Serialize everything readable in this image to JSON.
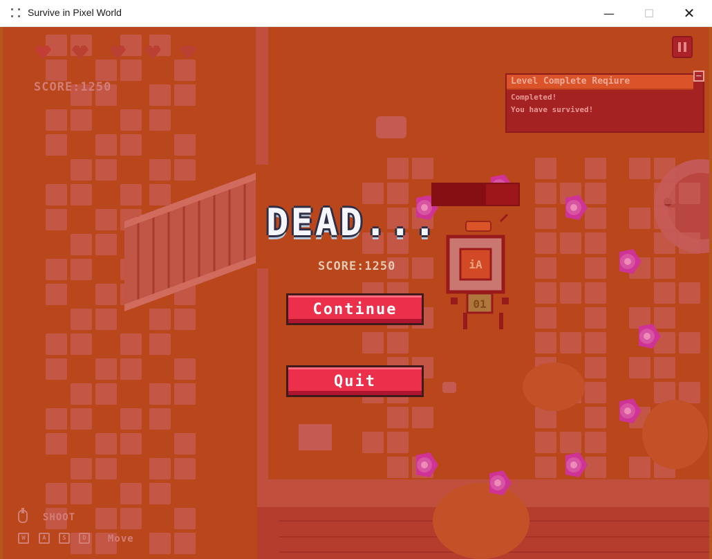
{
  "window": {
    "title": "Survive in Pixel World",
    "minimize_label": "—",
    "maximize_label": "☐",
    "close_label": "✕"
  },
  "hud": {
    "hearts": [
      {
        "icon": "heart-icon",
        "state": "full"
      },
      {
        "icon": "heart-icon",
        "state": "empty"
      },
      {
        "icon": "heart-icon",
        "state": "empty"
      },
      {
        "icon": "heart-icon",
        "state": "empty"
      },
      {
        "icon": "heart-icon",
        "state": "empty"
      }
    ],
    "score_text": "SCORE:1250",
    "pause_icon": "pause-icon"
  },
  "quest_panel": {
    "header": "Level Complete Reqiure",
    "collapse_label": "−",
    "lines": [
      "Completed!",
      "You have survived!"
    ]
  },
  "death_screen": {
    "title": "DEAD...",
    "score_text": "SCORE:1250",
    "continue_label": "Continue",
    "quit_label": "Quit"
  },
  "robot": {
    "chip_label": "iA",
    "screen_label": "01",
    "health_fraction": 0.62
  },
  "controls": {
    "shoot_label": "SHOOT",
    "move_label": "Move",
    "keys": [
      "W",
      "A",
      "S",
      "D"
    ],
    "shoot_icon": "mouse-icon"
  },
  "colors": {
    "ground": "#b7581c",
    "overlay": "#c31e1e",
    "button": "#ec2f4a",
    "quest_header": "#e56a2e",
    "enemy": "#d43cc4"
  }
}
